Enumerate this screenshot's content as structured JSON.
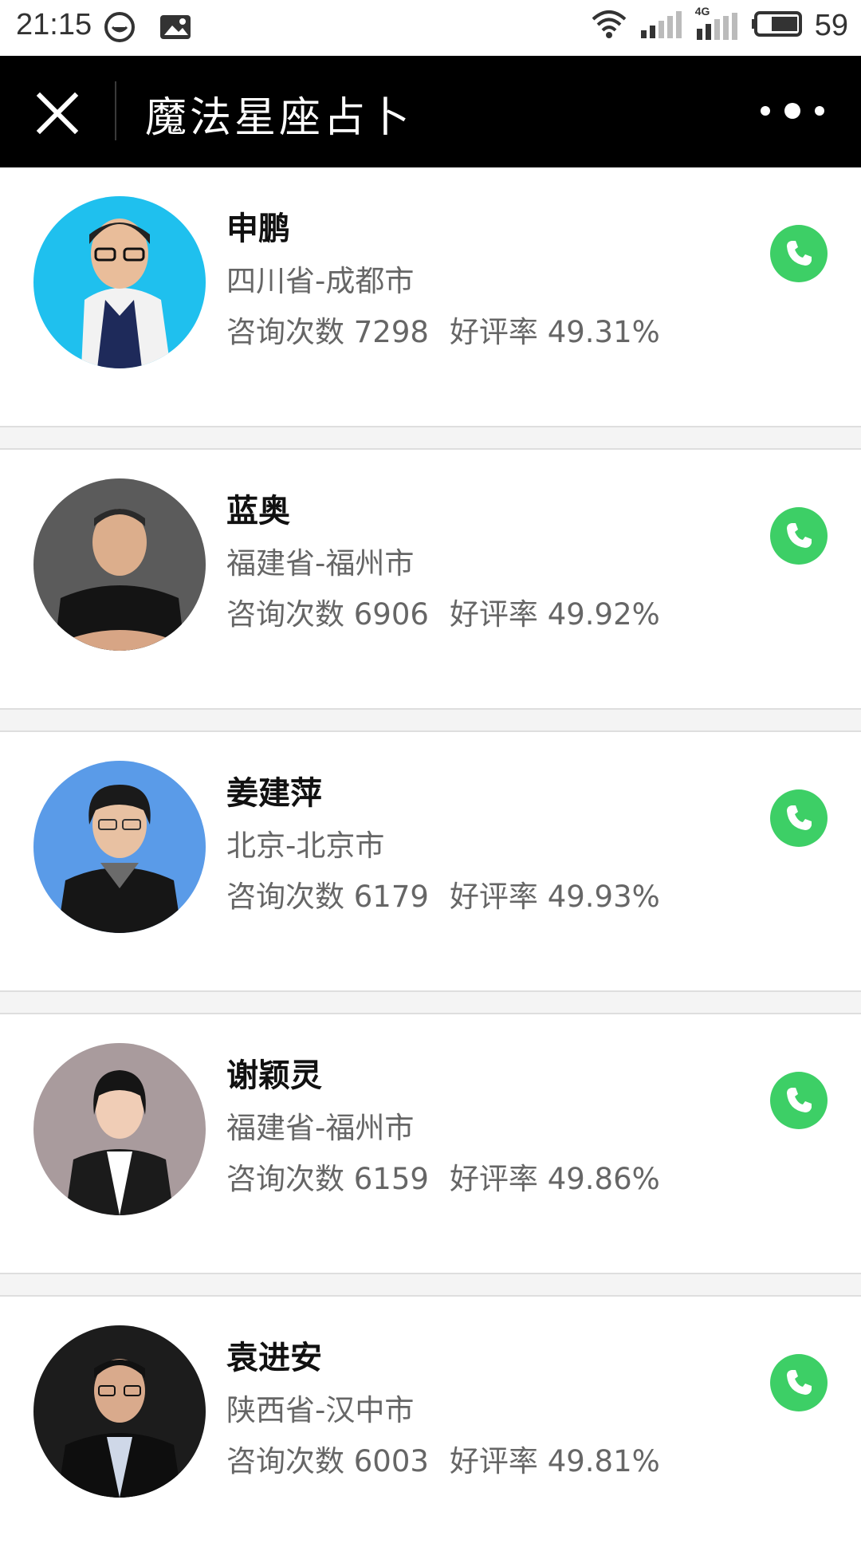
{
  "status_bar": {
    "time": "21:15",
    "network": "4G",
    "battery": "59"
  },
  "title_bar": {
    "title": "魔法星座占卜"
  },
  "advisors": [
    {
      "name": "申鹏",
      "location": "四川省-成都市",
      "consult_label": "咨询次数",
      "consult_count": "7298",
      "rating_label": "好评率",
      "rating": "49.31%",
      "avatar_bg": "#1fc0ee"
    },
    {
      "name": "蓝奥",
      "location": "福建省-福州市",
      "consult_label": "咨询次数",
      "consult_count": "6906",
      "rating_label": "好评率",
      "rating": "49.92%",
      "avatar_bg": "#5b5b5b"
    },
    {
      "name": "姜建萍",
      "location": "北京-北京市",
      "consult_label": "咨询次数",
      "consult_count": "6179",
      "rating_label": "好评率",
      "rating": "49.93%",
      "avatar_bg": "#5a9be8"
    },
    {
      "name": "谢颖灵",
      "location": "福建省-福州市",
      "consult_label": "咨询次数",
      "consult_count": "6159",
      "rating_label": "好评率",
      "rating": "49.86%",
      "avatar_bg": "#a99b9d"
    },
    {
      "name": "袁进安",
      "location": "陕西省-汉中市",
      "consult_label": "咨询次数",
      "consult_count": "6003",
      "rating_label": "好评率",
      "rating": "49.81%",
      "avatar_bg": "#1c1c1c"
    }
  ],
  "colors": {
    "call_button": "#3dcf66",
    "title_bar_bg": "#000000"
  }
}
